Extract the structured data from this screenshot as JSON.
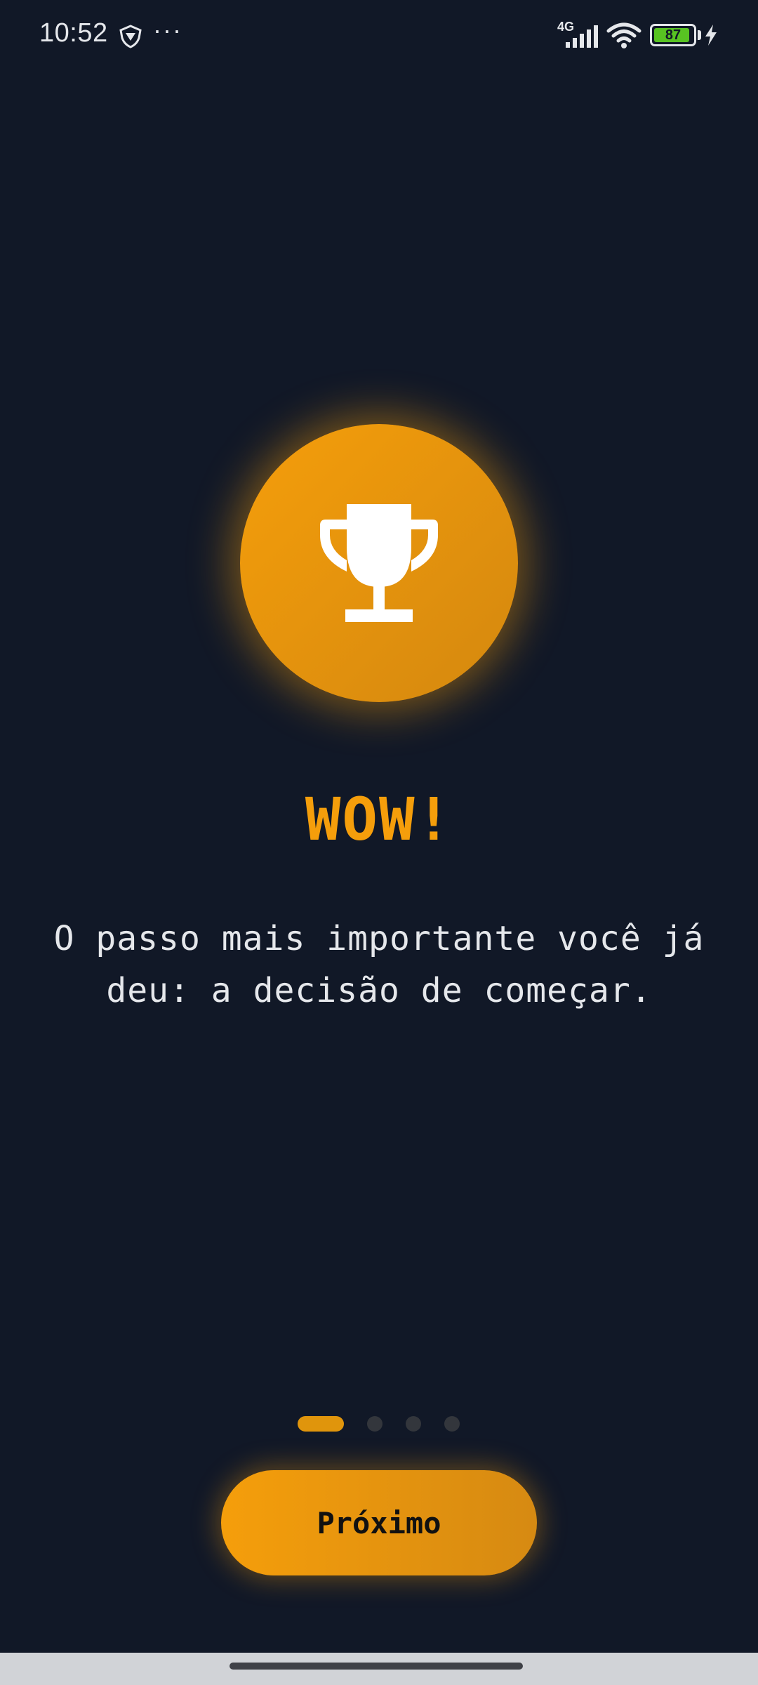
{
  "status_bar": {
    "time": "10:52",
    "dots": "···",
    "network_type": "4G",
    "battery_level": "87",
    "icons": [
      "vpn-shield-icon",
      "signal-icon",
      "wifi-icon",
      "battery-icon",
      "charging-bolt-icon"
    ]
  },
  "hero": {
    "icon": "trophy-icon",
    "title": "WOW!",
    "subtitle": "O passo mais importante você já deu: a decisão de começar."
  },
  "pagination": {
    "total_pages": 4,
    "current_page": 1
  },
  "actions": {
    "next_label": "Próximo"
  },
  "colors": {
    "background": "#111827",
    "accent": "#f59e0b",
    "accent_dark": "#d4880f",
    "text": "#e5e7eb",
    "battery_fill": "#58c322",
    "pager_inactive": "#33363c"
  }
}
